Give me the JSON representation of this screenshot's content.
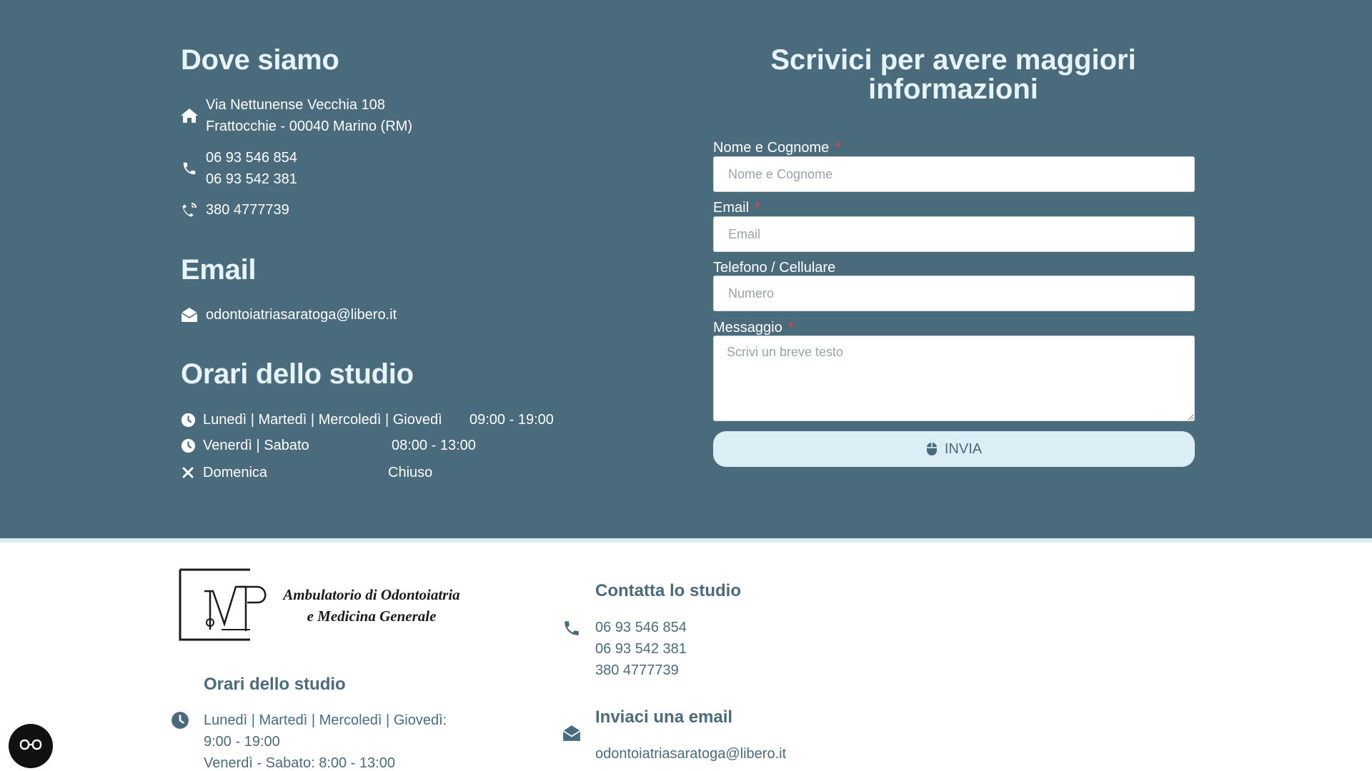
{
  "location": {
    "heading": "Dove siamo",
    "address_line1": "Via Nettunense Vecchia 108",
    "address_line2": "Frattocchie - 00040 Marino (RM)",
    "phone1": "06 93 546 854",
    "phone2": "06 93 542 381",
    "mobile": "380 4777739",
    "icons": [
      "home-icon",
      "phone-icon",
      "mobile-phone-icon"
    ]
  },
  "email_section": {
    "heading": "Email",
    "address": "odontoiatriasaratoga@libero.it",
    "icon": "envelope-open-icon"
  },
  "hours": {
    "heading": "Orari dello studio",
    "rows": [
      {
        "days": "Lunedì | Martedì | Mercoledì | Giovedì",
        "time": "09:00 - 19:00",
        "icon": "clock-icon"
      },
      {
        "days": "Venerdì | Sabato",
        "time": "08:00 - 13:00",
        "icon": "clock-icon"
      },
      {
        "days": "Domenica",
        "time": "Chiuso",
        "icon": "close-icon"
      }
    ]
  },
  "form": {
    "title_line1": "Scrivici per avere maggiori",
    "title_line2": "informazioni",
    "required_mark": "*",
    "name": {
      "label": "Nome e Cognome",
      "placeholder": "Nome e Cognome"
    },
    "email": {
      "label": "Email",
      "placeholder": "Email"
    },
    "phone": {
      "label": "Telefono / Cellulare",
      "placeholder": "Numero"
    },
    "message": {
      "label": "Messaggio",
      "placeholder": "Scrivi un breve testo"
    },
    "submit_label": "INVIA",
    "submit_icon": "mouse-icon"
  },
  "footer": {
    "logo_line1": "Ambulatorio di Odontoiatria",
    "logo_line2": "e Medicina Generale",
    "hours_heading": "Orari dello studio",
    "hours_line1": "Lunedì | Martedì | Mercoledì | Giovedì:",
    "hours_line2": "9:00 - 19:00",
    "hours_line3": "Venerdì - Sabato: 8:00 - 13:00",
    "contact_heading": "Contatta lo studio",
    "contact_phone1": "06 93 546 854",
    "contact_phone2": "06 93 542 381",
    "contact_mobile": "380 4777739",
    "email_heading": "Inviaci una email",
    "email_address": "odontoiatriasaratoga@libero.it"
  },
  "colors": {
    "top_background": "#4a6b7c",
    "accent_light": "#dceef5",
    "footer_text": "#4a6b7c",
    "required": "#e04848"
  },
  "accessibility_button": {
    "icon": "accessibility-glasses-icon"
  }
}
